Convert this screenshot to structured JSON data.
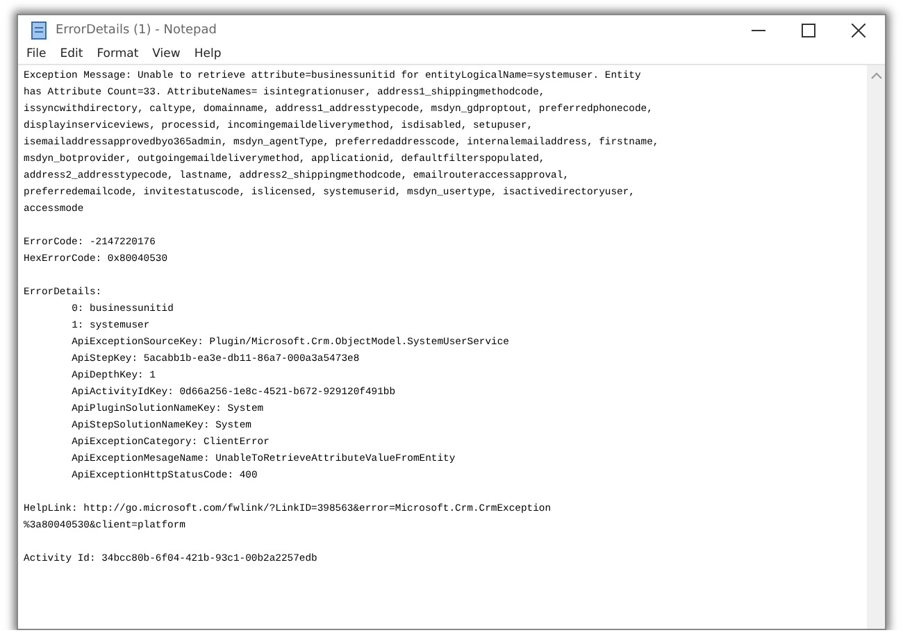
{
  "window": {
    "title": "ErrorDetails (1) - Notepad"
  },
  "menu": [
    {
      "label": "File"
    },
    {
      "label": "Edit"
    },
    {
      "label": "Format"
    },
    {
      "label": "View"
    },
    {
      "label": "Help"
    }
  ],
  "document": {
    "paragraphs": [
      {
        "lines": [
          {
            "text": "Exception Message: Unable to retrieve attribute=businessunitid for entityLogicalName=systemuser. Entity",
            "indented": false
          },
          {
            "text": "has Attribute Count=33. AttributeNames= isintegrationuser, address1_shippingmethodcode,",
            "indented": false
          },
          {
            "text": "issyncwithdirectory, caltype, domainname, address1_addresstypecode, msdyn_gdproptout, preferredphonecode,",
            "indented": false
          },
          {
            "text": "displayinserviceviews, processid, incomingemaildeliverymethod, isdisabled, setupuser,",
            "indented": false
          },
          {
            "text": "isemailaddressapprovedbyo365admin, msdyn_agentType, preferredaddresscode, internalemailaddress, firstname,",
            "indented": false
          },
          {
            "text": "msdyn_botprovider, outgoingemaildeliverymethod, applicationid, defaultfilterspopulated,",
            "indented": false
          },
          {
            "text": "address2_addresstypecode, lastname, address2_shippingmethodcode, emailrouteraccessapproval,",
            "indented": false
          },
          {
            "text": "preferredemailcode, invitestatuscode, islicensed, systemuserid, msdyn_usertype, isactivedirectoryuser,",
            "indented": false
          },
          {
            "text": "accessmode",
            "indented": false
          }
        ]
      },
      {
        "lines": [
          {
            "text": "ErrorCode: -2147220176",
            "indented": false
          },
          {
            "text": "HexErrorCode: 0x80040530",
            "indented": false
          }
        ]
      },
      {
        "lines": [
          {
            "text": "ErrorDetails:",
            "indented": false
          },
          {
            "text": "0: businessunitid",
            "indented": true
          },
          {
            "text": "1: systemuser",
            "indented": true
          },
          {
            "text": "ApiExceptionSourceKey: Plugin/Microsoft.Crm.ObjectModel.SystemUserService",
            "indented": true
          },
          {
            "text": "ApiStepKey: 5acabb1b-ea3e-db11-86a7-000a3a5473e8",
            "indented": true
          },
          {
            "text": "ApiDepthKey: 1",
            "indented": true
          },
          {
            "text": "ApiActivityIdKey: 0d66a256-1e8c-4521-b672-929120f491bb",
            "indented": true
          },
          {
            "text": "ApiPluginSolutionNameKey: System",
            "indented": true
          },
          {
            "text": "ApiStepSolutionNameKey: System",
            "indented": true
          },
          {
            "text": "ApiExceptionCategory: ClientError",
            "indented": true
          },
          {
            "text": "ApiExceptionMesageName: UnableToRetrieveAttributeValueFromEntity",
            "indented": true
          },
          {
            "text": "ApiExceptionHttpStatusCode: 400",
            "indented": true
          }
        ]
      },
      {
        "lines": [
          {
            "text": "HelpLink: http://go.microsoft.com/fwlink/?LinkID=398563&error=Microsoft.Crm.CrmException",
            "indented": false
          },
          {
            "text": "%3a80040530&client=platform",
            "indented": false
          }
        ]
      },
      {
        "lines": [
          {
            "text": "Activity Id: 34bcc80b-6f04-421b-93c1-00b2a2257edb",
            "indented": false
          }
        ]
      }
    ]
  }
}
